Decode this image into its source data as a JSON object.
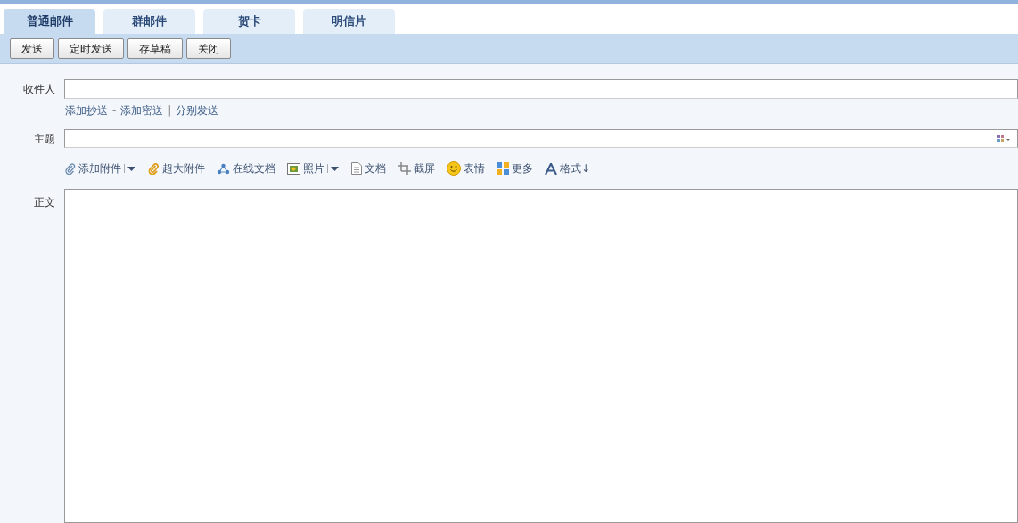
{
  "tabs": [
    {
      "label": "普通邮件",
      "selected": true
    },
    {
      "label": "群邮件",
      "selected": false
    },
    {
      "label": "贺卡",
      "selected": false
    },
    {
      "label": "明信片",
      "selected": false
    }
  ],
  "actions": [
    "发送",
    "定时发送",
    "存草稿",
    "关闭"
  ],
  "recipient": {
    "label": "收件人",
    "links": [
      {
        "kind": "link",
        "text": "添加抄送"
      },
      {
        "kind": "sep",
        "text": "-"
      },
      {
        "kind": "link",
        "text": "添加密送"
      },
      {
        "kind": "sep",
        "text": "|"
      },
      {
        "kind": "link",
        "text": "分别发送"
      }
    ]
  },
  "subject": {
    "label": "主题"
  },
  "attach_toolbar": [
    {
      "kind": "paperclip",
      "label": "添加附件",
      "dropdown": true
    },
    {
      "kind": "bigclip",
      "label": "超大附件",
      "dropdown": false
    },
    {
      "kind": "share",
      "label": "在线文档",
      "dropdown": false
    },
    {
      "kind": "photo",
      "label": "照片",
      "dropdown": true
    },
    {
      "kind": "doc",
      "label": "文档",
      "dropdown": false
    },
    {
      "kind": "scissors",
      "label": "截屏",
      "dropdown": false
    },
    {
      "kind": "smiley",
      "label": "表情",
      "dropdown": false
    },
    {
      "kind": "grid",
      "label": "更多",
      "dropdown": false
    },
    {
      "kind": "font",
      "label": "格式↓",
      "dropdown": false
    }
  ],
  "body": {
    "label": "正文"
  }
}
